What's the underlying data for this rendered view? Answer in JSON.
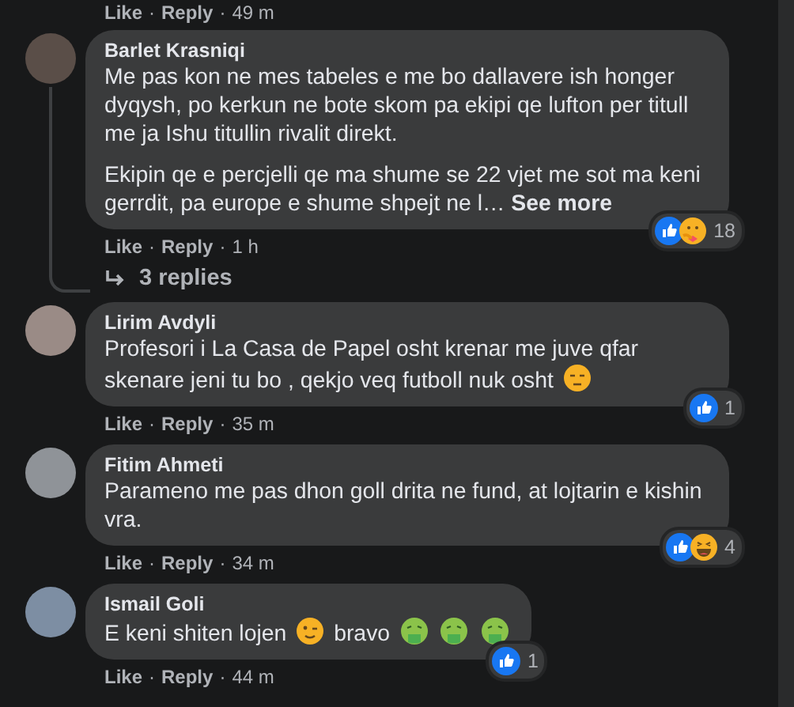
{
  "top_meta": {
    "like": "Like",
    "sep1": "·",
    "reply": "Reply",
    "sep2": "·",
    "time": "49 m"
  },
  "comments": [
    {
      "author": "Barlet Krasniqi",
      "paragraphs": [
        [
          {
            "kind": "text",
            "text": "Me pas kon ne mes tabeles e me bo dallavere ish honger dyqysh, po kerkun ne bote skom pa ekipi qe lufton per titull me ja Ishu titullin rivalit direkt."
          }
        ],
        [
          {
            "kind": "text",
            "text": "Ekipin qe e percjelli qe ma shume se 22 vjet me sot ma keni gerrdit, pa europe e shume shpejt ne l…"
          },
          {
            "kind": "link",
            "text": "See more"
          }
        ]
      ],
      "reactions": [
        {
          "kind": "like"
        },
        {
          "kind": "care"
        }
      ],
      "reaction_count": "18",
      "meta": {
        "like": "Like",
        "sep1": "·",
        "reply": "Reply",
        "sep2": "·",
        "time": "1 h"
      },
      "replies": "3 replies"
    },
    {
      "author": "Lirim Avdyli",
      "paragraphs": [
        [
          {
            "kind": "text",
            "text": "Profesori i La Casa de Papel osht krenar me juve qfar skenare jeni tu bo , qekjo veq futboll nuk osht"
          },
          {
            "kind": "unamused"
          }
        ]
      ],
      "reactions": [
        {
          "kind": "like"
        }
      ],
      "reaction_count": "1",
      "meta": {
        "like": "Like",
        "sep1": "·",
        "reply": "Reply",
        "sep2": "·",
        "time": "35 m"
      }
    },
    {
      "author": "Fitim Ahmeti",
      "paragraphs": [
        [
          {
            "kind": "text",
            "text": "Parameno me pas dhon goll drita ne fund, at lojtarin e kishin vra."
          }
        ]
      ],
      "reactions": [
        {
          "kind": "like"
        },
        {
          "kind": "haha"
        }
      ],
      "reaction_count": "4",
      "meta": {
        "like": "Like",
        "sep1": "·",
        "reply": "Reply",
        "sep2": "·",
        "time": "34 m"
      }
    },
    {
      "author": "Ismail Goli",
      "paragraphs": [
        [
          {
            "kind": "text",
            "text": "E keni shiten lojen"
          },
          {
            "kind": "wink"
          },
          {
            "kind": "text",
            "text": "bravo"
          },
          {
            "kind": "vomit"
          },
          {
            "kind": "vomit"
          },
          {
            "kind": "vomit"
          }
        ]
      ],
      "reactions": [
        {
          "kind": "like"
        }
      ],
      "reaction_count": "1",
      "meta": {
        "like": "Like",
        "sep1": "·",
        "reply": "Reply",
        "sep2": "·",
        "time": "44 m"
      }
    }
  ]
}
